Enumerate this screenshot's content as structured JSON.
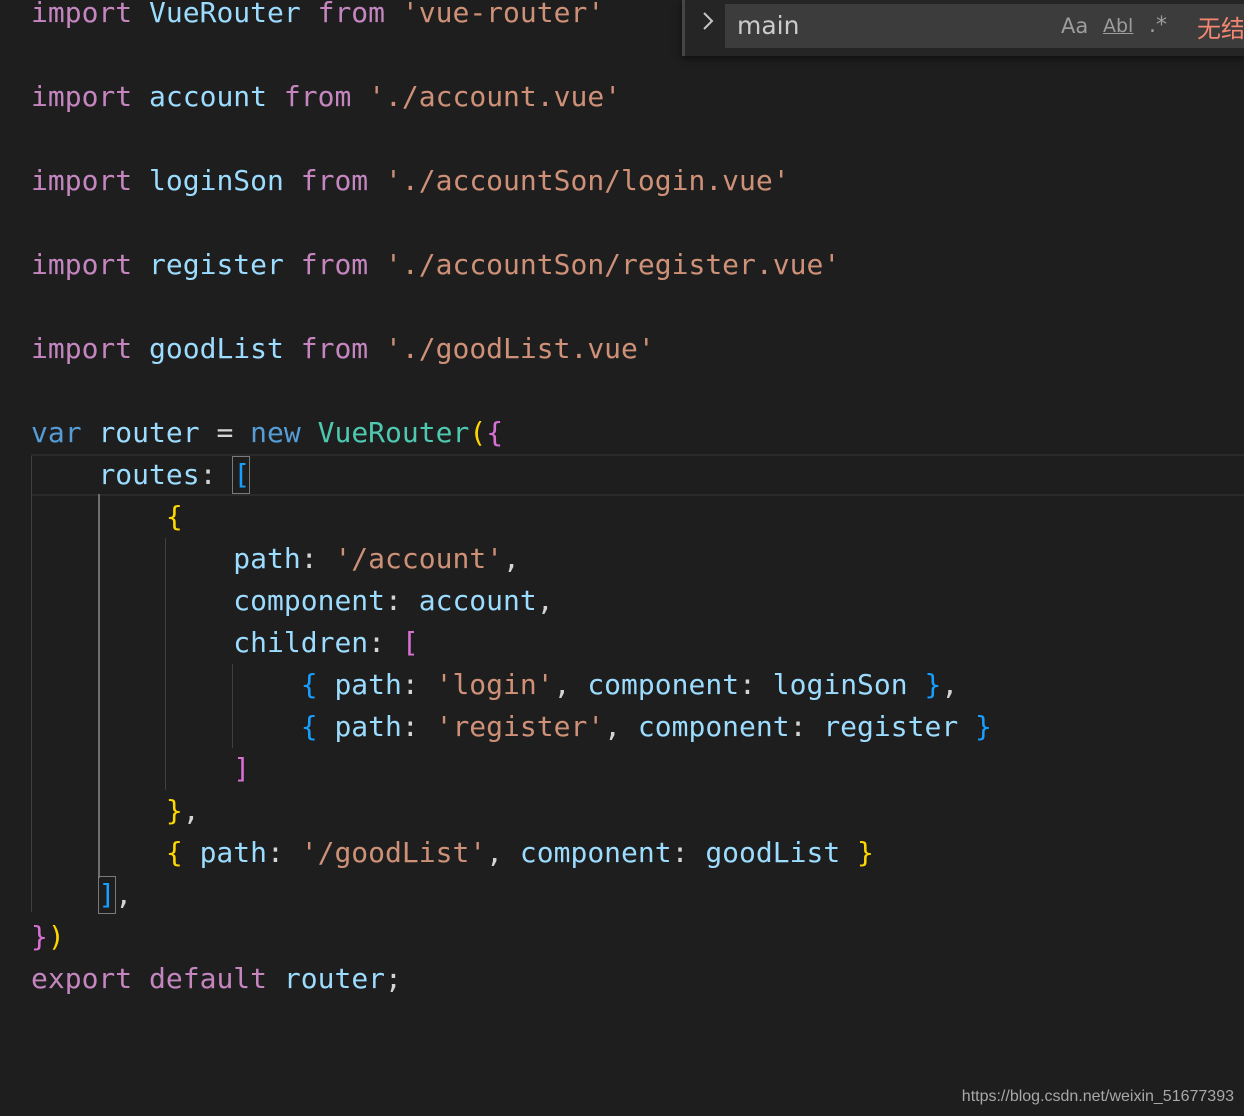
{
  "editor": {
    "lines": [
      {
        "tokens": [
          {
            "t": "import",
            "c": "kw"
          },
          {
            "t": " ",
            "c": "pl"
          },
          {
            "t": "VueRouter",
            "c": "id"
          },
          {
            "t": " ",
            "c": "pl"
          },
          {
            "t": "from",
            "c": "kw"
          },
          {
            "t": " ",
            "c": "pl"
          },
          {
            "t": "'vue-router'",
            "c": "str"
          }
        ]
      },
      {
        "tokens": []
      },
      {
        "tokens": [
          {
            "t": "import",
            "c": "kw"
          },
          {
            "t": " ",
            "c": "pl"
          },
          {
            "t": "account",
            "c": "id"
          },
          {
            "t": " ",
            "c": "pl"
          },
          {
            "t": "from",
            "c": "kw"
          },
          {
            "t": " ",
            "c": "pl"
          },
          {
            "t": "'./account.vue'",
            "c": "str"
          }
        ]
      },
      {
        "tokens": []
      },
      {
        "tokens": [
          {
            "t": "import",
            "c": "kw"
          },
          {
            "t": " ",
            "c": "pl"
          },
          {
            "t": "loginSon",
            "c": "id"
          },
          {
            "t": " ",
            "c": "pl"
          },
          {
            "t": "from",
            "c": "kw"
          },
          {
            "t": " ",
            "c": "pl"
          },
          {
            "t": "'./accountSon/login.vue'",
            "c": "str"
          }
        ]
      },
      {
        "tokens": []
      },
      {
        "tokens": [
          {
            "t": "import",
            "c": "kw"
          },
          {
            "t": " ",
            "c": "pl"
          },
          {
            "t": "register",
            "c": "id"
          },
          {
            "t": " ",
            "c": "pl"
          },
          {
            "t": "from",
            "c": "kw"
          },
          {
            "t": " ",
            "c": "pl"
          },
          {
            "t": "'./accountSon/register.vue'",
            "c": "str"
          }
        ]
      },
      {
        "tokens": []
      },
      {
        "tokens": [
          {
            "t": "import",
            "c": "kw"
          },
          {
            "t": " ",
            "c": "pl"
          },
          {
            "t": "goodList",
            "c": "id"
          },
          {
            "t": " ",
            "c": "pl"
          },
          {
            "t": "from",
            "c": "kw"
          },
          {
            "t": " ",
            "c": "pl"
          },
          {
            "t": "'./goodList.vue'",
            "c": "str"
          }
        ]
      },
      {
        "tokens": []
      },
      {
        "tokens": [
          {
            "t": "var",
            "c": "kwb"
          },
          {
            "t": " ",
            "c": "pl"
          },
          {
            "t": "router",
            "c": "id"
          },
          {
            "t": " = ",
            "c": "pl"
          },
          {
            "t": "new",
            "c": "kwb"
          },
          {
            "t": " ",
            "c": "pl"
          },
          {
            "t": "VueRouter",
            "c": "cls"
          },
          {
            "t": "(",
            "c": "b1"
          },
          {
            "t": "{",
            "c": "b2"
          }
        ]
      },
      {
        "tokens": [
          {
            "t": "    ",
            "c": "pl"
          },
          {
            "t": "routes",
            "c": "id"
          },
          {
            "t": ": ",
            "c": "pl"
          },
          {
            "t": "[",
            "c": "b3"
          }
        ]
      },
      {
        "tokens": [
          {
            "t": "        ",
            "c": "pl"
          },
          {
            "t": "{",
            "c": "b1"
          }
        ]
      },
      {
        "tokens": [
          {
            "t": "            ",
            "c": "pl"
          },
          {
            "t": "path",
            "c": "id"
          },
          {
            "t": ": ",
            "c": "pl"
          },
          {
            "t": "'/account'",
            "c": "str"
          },
          {
            "t": ",",
            "c": "pl"
          }
        ]
      },
      {
        "tokens": [
          {
            "t": "            ",
            "c": "pl"
          },
          {
            "t": "component",
            "c": "id"
          },
          {
            "t": ": ",
            "c": "pl"
          },
          {
            "t": "account",
            "c": "id"
          },
          {
            "t": ",",
            "c": "pl"
          }
        ]
      },
      {
        "tokens": [
          {
            "t": "            ",
            "c": "pl"
          },
          {
            "t": "children",
            "c": "id"
          },
          {
            "t": ": ",
            "c": "pl"
          },
          {
            "t": "[",
            "c": "b2"
          }
        ]
      },
      {
        "tokens": [
          {
            "t": "                ",
            "c": "pl"
          },
          {
            "t": "{",
            "c": "b3"
          },
          {
            "t": " ",
            "c": "pl"
          },
          {
            "t": "path",
            "c": "id"
          },
          {
            "t": ": ",
            "c": "pl"
          },
          {
            "t": "'login'",
            "c": "str"
          },
          {
            "t": ", ",
            "c": "pl"
          },
          {
            "t": "component",
            "c": "id"
          },
          {
            "t": ": ",
            "c": "pl"
          },
          {
            "t": "loginSon",
            "c": "id"
          },
          {
            "t": " ",
            "c": "pl"
          },
          {
            "t": "}",
            "c": "b3"
          },
          {
            "t": ",",
            "c": "pl"
          }
        ]
      },
      {
        "tokens": [
          {
            "t": "                ",
            "c": "pl"
          },
          {
            "t": "{",
            "c": "b3"
          },
          {
            "t": " ",
            "c": "pl"
          },
          {
            "t": "path",
            "c": "id"
          },
          {
            "t": ": ",
            "c": "pl"
          },
          {
            "t": "'register'",
            "c": "str"
          },
          {
            "t": ", ",
            "c": "pl"
          },
          {
            "t": "component",
            "c": "id"
          },
          {
            "t": ": ",
            "c": "pl"
          },
          {
            "t": "register",
            "c": "id"
          },
          {
            "t": " ",
            "c": "pl"
          },
          {
            "t": "}",
            "c": "b3"
          }
        ]
      },
      {
        "tokens": [
          {
            "t": "            ",
            "c": "pl"
          },
          {
            "t": "]",
            "c": "b2"
          }
        ]
      },
      {
        "tokens": [
          {
            "t": "        ",
            "c": "pl"
          },
          {
            "t": "}",
            "c": "b1"
          },
          {
            "t": ",",
            "c": "pl"
          }
        ]
      },
      {
        "tokens": [
          {
            "t": "        ",
            "c": "pl"
          },
          {
            "t": "{",
            "c": "b1"
          },
          {
            "t": " ",
            "c": "pl"
          },
          {
            "t": "path",
            "c": "id"
          },
          {
            "t": ": ",
            "c": "pl"
          },
          {
            "t": "'/goodList'",
            "c": "str"
          },
          {
            "t": ", ",
            "c": "pl"
          },
          {
            "t": "component",
            "c": "id"
          },
          {
            "t": ": ",
            "c": "pl"
          },
          {
            "t": "goodList",
            "c": "id"
          },
          {
            "t": " ",
            "c": "pl"
          },
          {
            "t": "}",
            "c": "b1"
          }
        ]
      },
      {
        "tokens": [
          {
            "t": "    ",
            "c": "pl"
          },
          {
            "t": "]",
            "c": "b3"
          },
          {
            "t": ",",
            "c": "pl"
          }
        ]
      },
      {
        "tokens": [
          {
            "t": "}",
            "c": "b2"
          },
          {
            "t": ")",
            "c": "b1"
          }
        ]
      },
      {
        "tokens": [
          {
            "t": "export",
            "c": "kw"
          },
          {
            "t": " ",
            "c": "pl"
          },
          {
            "t": "default",
            "c": "kw"
          },
          {
            "t": " ",
            "c": "pl"
          },
          {
            "t": "router",
            "c": "id"
          },
          {
            "t": ";",
            "c": "pl"
          }
        ]
      }
    ]
  },
  "find_widget": {
    "toggle_icon": "chevron-right-icon",
    "query": "main",
    "match_case_label": "Aa",
    "whole_word_label": "Abl",
    "regex_label": ".*",
    "result_text": "无结果"
  },
  "colors": {
    "keyword": "#c586c0",
    "keyword_blue": "#569cd6",
    "identifier": "#9cdcfe",
    "class": "#4ec9b0",
    "string": "#ce9178",
    "no_results": "#f48771"
  },
  "watermark": "https://blog.csdn.net/weixin_51677393"
}
